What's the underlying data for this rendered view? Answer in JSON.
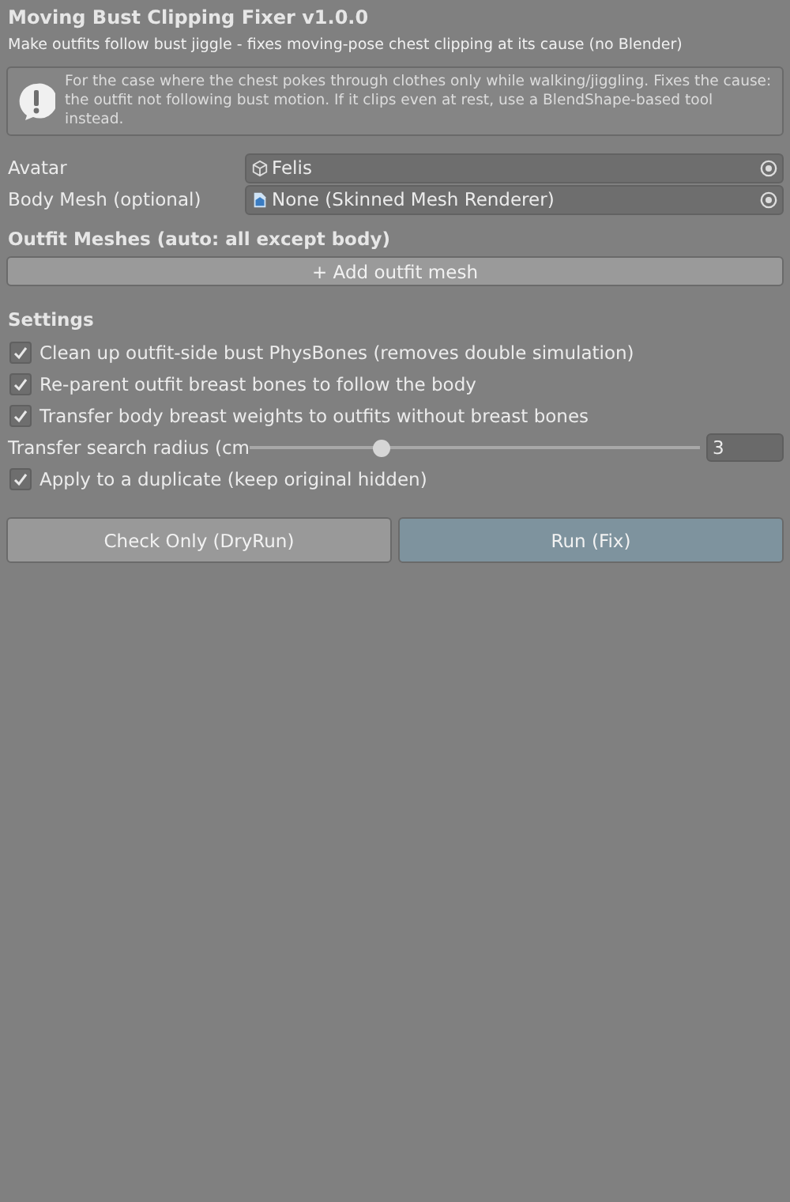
{
  "title": "Moving Bust Clipping Fixer v1.0.0",
  "subtitle": "Make outfits follow bust jiggle - fixes moving-pose chest clipping at its cause (no Blender)",
  "info": "For the case where the chest pokes through clothes only while walking/jiggling. Fixes the cause: the outfit not following bust motion. If it clips even at rest, use a BlendShape-based tool instead.",
  "fields": [
    {
      "label": "Avatar",
      "value": "Felis",
      "kind": "object"
    },
    {
      "label": "Body Mesh (optional)",
      "value": "None (Skinned Mesh Renderer)",
      "kind": "mesh"
    }
  ],
  "outfits": {
    "heading": "Outfit Meshes (auto: all except body)",
    "button": "+ Add outfit mesh"
  },
  "settings": {
    "heading": "Settings",
    "items": [
      {
        "kind": "checkbox",
        "label": "Clean up outfit-side bust PhysBones (removes double simulation)",
        "checked": true
      },
      {
        "kind": "checkbox",
        "label": "Re-parent outfit breast bones to follow the body",
        "checked": true
      },
      {
        "kind": "checkbox",
        "label": "Transfer body breast weights to outfits without breast bones",
        "checked": true
      },
      {
        "kind": "slider",
        "label": "Transfer search radius (cm",
        "level": 0.29,
        "value": "3"
      },
      {
        "kind": "checkbox",
        "label": "Apply to a duplicate (keep original hidden)",
        "checked": true
      }
    ]
  },
  "buttons": [
    {
      "label": "Check Only (DryRun)",
      "primary": false
    },
    {
      "label": "Run (Fix)",
      "primary": true
    }
  ]
}
